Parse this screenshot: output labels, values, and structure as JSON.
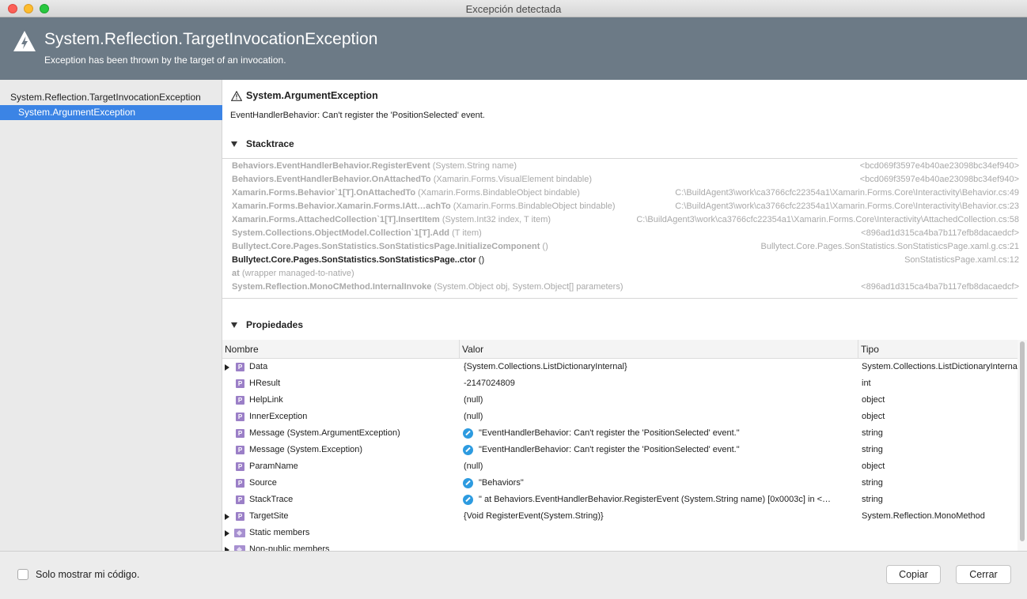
{
  "window": {
    "title": "Excepción detectada"
  },
  "header": {
    "title": "System.Reflection.TargetInvocationException",
    "subtitle": "Exception has been thrown by the target of an invocation."
  },
  "sidebar": {
    "items": [
      {
        "label": "System.Reflection.TargetInvocationException"
      },
      {
        "label": "System.ArgumentException"
      }
    ]
  },
  "exception": {
    "name": "System.ArgumentException",
    "message": "EventHandlerBehavior: Can't register the 'PositionSelected' event."
  },
  "stacktrace": {
    "heading": "Stacktrace",
    "frames": [
      {
        "method": "Behaviors.EventHandlerBehavior.RegisterEvent",
        "args": " (System.String name)",
        "location": "<bcd069f3597e4b40ae23098bc34ef940>"
      },
      {
        "method": "Behaviors.EventHandlerBehavior.OnAttachedTo",
        "args": " (Xamarin.Forms.VisualElement bindable)",
        "location": "<bcd069f3597e4b40ae23098bc34ef940>"
      },
      {
        "method": "Xamarin.Forms.Behavior`1[T].OnAttachedTo",
        "args": " (Xamarin.Forms.BindableObject bindable)",
        "location": "C:\\BuildAgent3\\work\\ca3766cfc22354a1\\Xamarin.Forms.Core\\Interactivity\\Behavior.cs:49"
      },
      {
        "method": "Xamarin.Forms.Behavior.Xamarin.Forms.IAtt…achTo",
        "args": " (Xamarin.Forms.BindableObject bindable)",
        "location": "C:\\BuildAgent3\\work\\ca3766cfc22354a1\\Xamarin.Forms.Core\\Interactivity\\Behavior.cs:23"
      },
      {
        "method": "Xamarin.Forms.AttachedCollection`1[T].InsertItem",
        "args": " (System.Int32 index, T item)",
        "location": "C:\\BuildAgent3\\work\\ca3766cfc22354a1\\Xamarin.Forms.Core\\Interactivity\\AttachedCollection.cs:58"
      },
      {
        "method": "System.Collections.ObjectModel.Collection`1[T].Add",
        "args": " (T item)",
        "location": "<896ad1d315ca4ba7b117efb8dacaedcf>"
      },
      {
        "method": "Bullytect.Core.Pages.SonStatistics.SonStatisticsPage.InitializeComponent",
        "args": " ()",
        "location": "Bullytect.Core.Pages.SonStatistics.SonStatisticsPage.xaml.g.cs:21"
      },
      {
        "method": "Bullytect.Core.Pages.SonStatistics.SonStatisticsPage..ctor",
        "args": " ()",
        "location": "SonStatisticsPage.xaml.cs:12"
      },
      {
        "method": "at",
        "args": " (wrapper managed-to-native)",
        "location": ""
      },
      {
        "method": "System.Reflection.MonoCMethod.InternalInvoke",
        "args": " (System.Object obj, System.Object[] parameters)",
        "location": "<896ad1d315ca4ba7b117efb8dacaedcf>"
      }
    ]
  },
  "properties": {
    "heading": "Propiedades",
    "columns": {
      "name": "Nombre",
      "value": "Valor",
      "type": "Tipo"
    },
    "icon_letter": "P",
    "rows": [
      {
        "name": "Data",
        "value": "{System.Collections.ListDictionaryInternal}",
        "type": "System.Collections.ListDictionaryInternal"
      },
      {
        "name": "HResult",
        "value": "-2147024809",
        "type": "int"
      },
      {
        "name": "HelpLink",
        "value": "(null)",
        "type": "object"
      },
      {
        "name": "InnerException",
        "value": "(null)",
        "type": "object"
      },
      {
        "name": "Message (System.ArgumentException)",
        "value": "\"EventHandlerBehavior: Can't register the 'PositionSelected' event.\"",
        "type": "string"
      },
      {
        "name": "Message (System.Exception)",
        "value": "\"EventHandlerBehavior: Can't register the 'PositionSelected' event.\"",
        "type": "string"
      },
      {
        "name": "ParamName",
        "value": "(null)",
        "type": "object"
      },
      {
        "name": "Source",
        "value": "\"Behaviors\"",
        "type": "string"
      },
      {
        "name": "StackTrace",
        "value": "\"  at Behaviors.EventHandlerBehavior.RegisterEvent (System.String name) [0x0003c] in <…",
        "type": "string"
      },
      {
        "name": "TargetSite",
        "value": "{Void RegisterEvent(System.String)}",
        "type": "System.Reflection.MonoMethod"
      },
      {
        "name": "Static members"
      },
      {
        "name": "Non-public members"
      }
    ]
  },
  "footer": {
    "checkbox_label": "Solo mostrar mi código.",
    "copy_label": "Copiar",
    "close_label": "Cerrar"
  },
  "colors": {
    "header_bg": "#6c7a86",
    "selection": "#3b84e5",
    "property_icon": "#9b7fc7",
    "edit_icon": "#2d9be0"
  }
}
